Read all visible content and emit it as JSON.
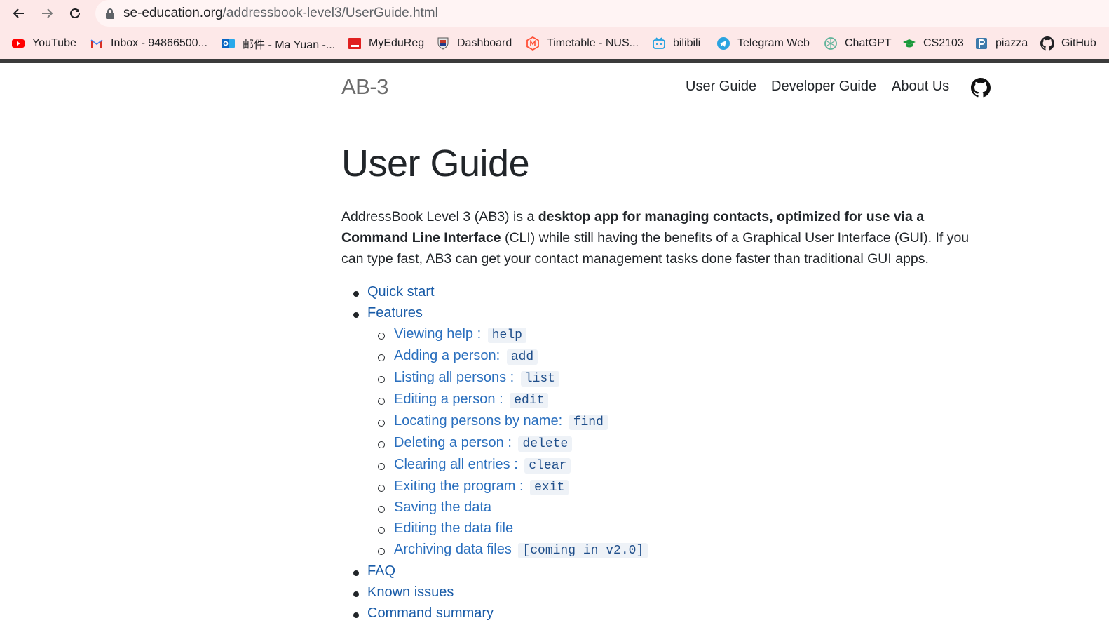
{
  "browser": {
    "url_domain": "se-education.org",
    "url_path": "/addressbook-level3/UserGuide.html",
    "bookmarks": [
      {
        "label": "YouTube",
        "icon": "youtube-icon"
      },
      {
        "label": "Inbox - 94866500...",
        "icon": "gmail-icon"
      },
      {
        "label": "邮件 - Ma Yuan -...",
        "icon": "outlook-icon"
      },
      {
        "label": "MyEduReg",
        "icon": "myedureg-icon"
      },
      {
        "label": "Dashboard",
        "icon": "nus-crest-icon"
      },
      {
        "label": "Timetable - NUS...",
        "icon": "nusmods-icon"
      },
      {
        "label": "bilibili",
        "icon": "bilibili-icon"
      },
      {
        "label": "Telegram Web",
        "icon": "telegram-icon"
      },
      {
        "label": "ChatGPT",
        "icon": "chatgpt-icon"
      },
      {
        "label": "CS2103",
        "icon": "graduation-cap-icon"
      },
      {
        "label": "piazza",
        "icon": "piazza-icon"
      },
      {
        "label": "GitHub",
        "icon": "github-icon"
      }
    ]
  },
  "site": {
    "brand": "AB-3",
    "nav": [
      "User Guide",
      "Developer Guide",
      "About Us"
    ]
  },
  "page": {
    "title": "User Guide",
    "intro_1": "AddressBook Level 3 (AB3) is a ",
    "intro_bold_1": "desktop app for managing contacts, optimized for use via a Command Line Interface",
    "intro_2": " (CLI) while still having the benefits of a Graphical User Interface (GUI). If you can type fast, AB3 can get your contact management tasks done faster than traditional GUI apps.",
    "toc": {
      "quick_start": "Quick start",
      "features": "Features",
      "feature_items": [
        {
          "label": "Viewing help : ",
          "code": "help"
        },
        {
          "label": "Adding a person: ",
          "code": "add"
        },
        {
          "label": "Listing all persons : ",
          "code": "list"
        },
        {
          "label": "Editing a person : ",
          "code": "edit"
        },
        {
          "label": "Locating persons by name: ",
          "code": "find"
        },
        {
          "label": "Deleting a person : ",
          "code": "delete"
        },
        {
          "label": "Clearing all entries : ",
          "code": "clear"
        },
        {
          "label": "Exiting the program : ",
          "code": "exit"
        },
        {
          "label": "Saving the data",
          "code": ""
        },
        {
          "label": "Editing the data file",
          "code": ""
        },
        {
          "label": "Archiving data files ",
          "code": "[coming in v2.0]"
        }
      ],
      "faq": "FAQ",
      "known_issues": "Known issues",
      "command_summary": "Command summary"
    }
  },
  "colors": {
    "link": "#1a5ca8",
    "chrome_bg": "#fde8e8",
    "code_bg": "#eef2f7"
  }
}
